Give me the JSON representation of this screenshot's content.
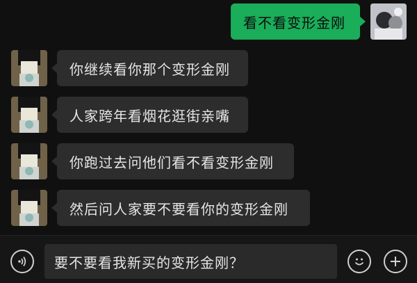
{
  "messages": [
    {
      "from": "me",
      "text": "看不看变形金刚"
    },
    {
      "from": "other",
      "text": "你继续看你那个变形金刚"
    },
    {
      "from": "other",
      "text": "人家跨年看烟花逛街亲嘴"
    },
    {
      "from": "other",
      "text": "你跑过去问他们看不看变形金刚"
    },
    {
      "from": "other",
      "text": "然后问人家要不要看你的变形金刚"
    }
  ],
  "input": {
    "value": "要不要看我新买的变形金刚？"
  },
  "icons": {
    "voice": "voice-icon",
    "emoji": "emoji-icon",
    "add": "plus-icon"
  },
  "colors": {
    "outgoing_bubble": "#1aad5a",
    "incoming_bubble": "#2d2d2d",
    "background": "#101010"
  }
}
